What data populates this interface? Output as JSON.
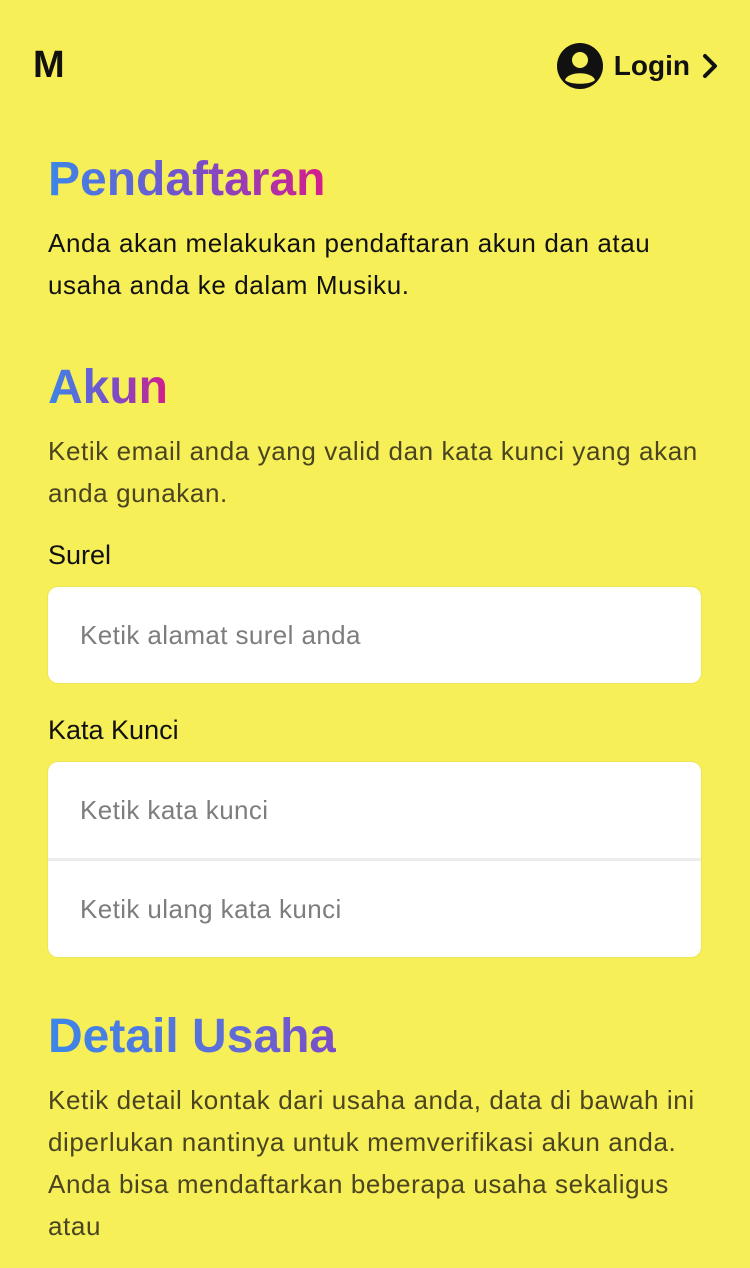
{
  "header": {
    "logo": "M",
    "login_label": "Login"
  },
  "intro": {
    "title": "Pendaftaran",
    "text": "Anda akan melakukan pendaftaran akun dan atau usaha anda ke dalam Musiku."
  },
  "account": {
    "title": "Akun",
    "text": "Ketik email anda yang valid dan kata kunci yang akan anda gunakan.",
    "email_label": "Surel",
    "email_placeholder": "Ketik  alamat surel anda",
    "password_label": "Kata Kunci",
    "password_placeholder": "Ketik kata kunci",
    "password_confirm_placeholder": "Ketik ulang kata kunci"
  },
  "business": {
    "title": "Detail Usaha",
    "text": "Ketik detail kontak dari usaha anda, data di bawah ini diperlukan nantinya untuk memverifikasi akun anda. Anda bisa mendaftarkan beberapa usaha sekaligus atau"
  },
  "colors": {
    "background": "#f7ef58",
    "gradient_start": "#3d86e8",
    "gradient_end": "#d61d8c"
  }
}
